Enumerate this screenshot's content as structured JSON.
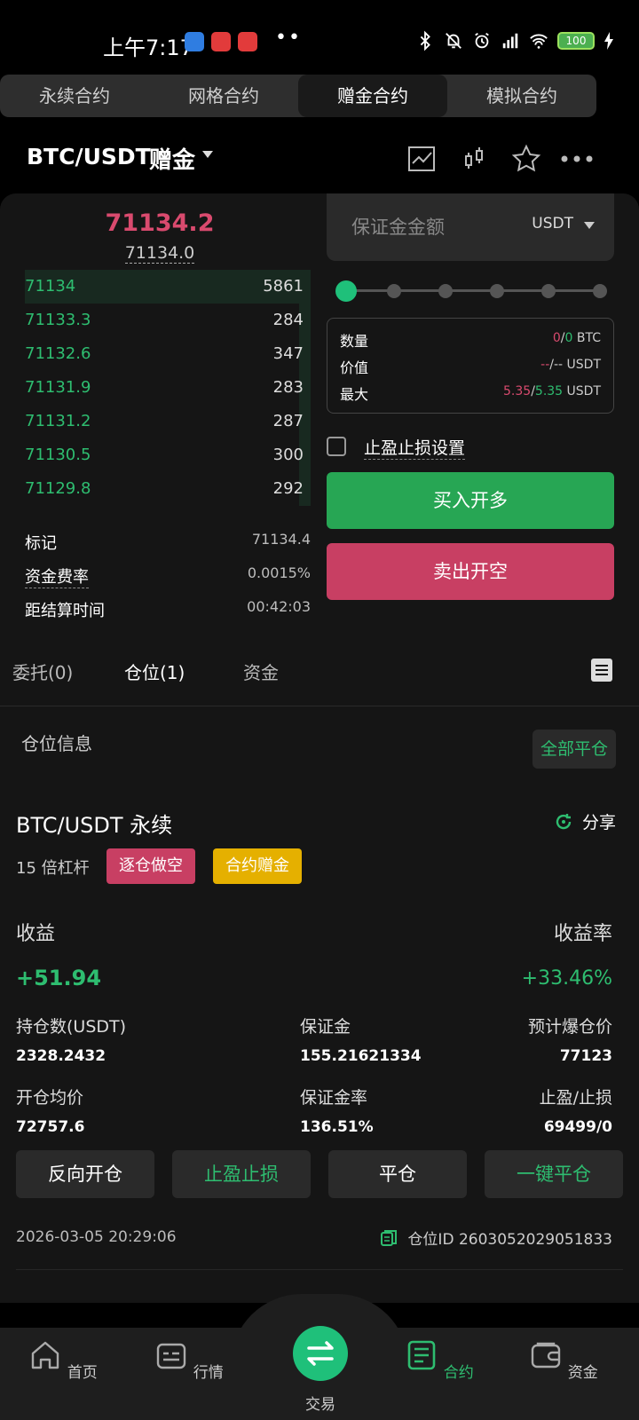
{
  "status_bar": {
    "time": "上午7:17",
    "battery": "100"
  },
  "top_tabs": [
    {
      "label": "永续合约"
    },
    {
      "label": "网格合约"
    },
    {
      "label": "赠金合约"
    },
    {
      "label": "模拟合约"
    }
  ],
  "pair": {
    "name": "BTC/USDT",
    "sub": "赠金"
  },
  "orderbook": {
    "last_price": "71134.2",
    "index_price": "71134.0",
    "rows": [
      {
        "price": "71134",
        "qty": "5861",
        "depth": 1.0
      },
      {
        "price": "71133.3",
        "qty": "284",
        "depth": 0.05
      },
      {
        "price": "71132.6",
        "qty": "347",
        "depth": 0.06
      },
      {
        "price": "71131.9",
        "qty": "283",
        "depth": 0.05
      },
      {
        "price": "71131.2",
        "qty": "287",
        "depth": 0.05
      },
      {
        "price": "71130.5",
        "qty": "300",
        "depth": 0.05
      },
      {
        "price": "71129.8",
        "qty": "292",
        "depth": 0.05
      }
    ],
    "stats": [
      {
        "label": "标记",
        "value": "71134.4"
      },
      {
        "label": "资金费率",
        "value": "0.0015%"
      },
      {
        "label": "距结算时间",
        "value": "00:42:03"
      }
    ]
  },
  "order_form": {
    "margin_placeholder": "保证金金额",
    "margin_unit": "USDT",
    "slider_level": 0,
    "info": [
      {
        "label": "数量",
        "v1": "0",
        "sep": "/",
        "v2": "0",
        "unit": " BTC"
      },
      {
        "label": "价值",
        "v1": "--",
        "sep": "/",
        "v2": "--",
        "unit": " USDT"
      },
      {
        "label": "最大",
        "v1": "5.35",
        "sep": "/",
        "v2": "5.35",
        "unit": " USDT"
      }
    ],
    "tpsl_label": "止盈止损设置",
    "buy_label": "买入开多",
    "sell_label": "卖出开空"
  },
  "sub_tabs": [
    {
      "label": "委托(0)"
    },
    {
      "label": "仓位(1)"
    },
    {
      "label": "资金"
    }
  ],
  "position": {
    "section_title": "仓位信息",
    "close_all_label": "全部平仓",
    "pair_label": "BTC/USDT 永续",
    "share_label": "分享",
    "leverage": "15 倍杠杆",
    "tag_side": "逐仓做空",
    "tag_type": "合约赠金",
    "pnl_label": "收益",
    "pnl_value": "+51.94",
    "roe_label": "收益率",
    "roe_value": "+33.46%",
    "fields": [
      {
        "label": "持仓数(USDT)",
        "value": "2328.2432"
      },
      {
        "label": "保证金",
        "value": "155.21621334"
      },
      {
        "label": "预计爆仓价",
        "value": "77123"
      },
      {
        "label": "开仓均价",
        "value": "72757.6"
      },
      {
        "label": "保证金率",
        "value": "136.51%"
      },
      {
        "label": "止盈/止损",
        "value": "69499/0"
      }
    ],
    "actions": [
      {
        "label": "反向开仓"
      },
      {
        "label": "止盈止损"
      },
      {
        "label": "平仓"
      },
      {
        "label": "一键平仓"
      }
    ],
    "timestamp": "2026-03-05 20:29:06",
    "position_id": "仓位ID 2603052029051833"
  },
  "bottom_nav": [
    {
      "label": "首页"
    },
    {
      "label": "行情"
    },
    {
      "label": "交易"
    },
    {
      "label": "合约"
    },
    {
      "label": "资金"
    }
  ],
  "colors": {
    "green": "#2ebd70",
    "red": "#d94a6e",
    "yellow": "#e5b000"
  }
}
